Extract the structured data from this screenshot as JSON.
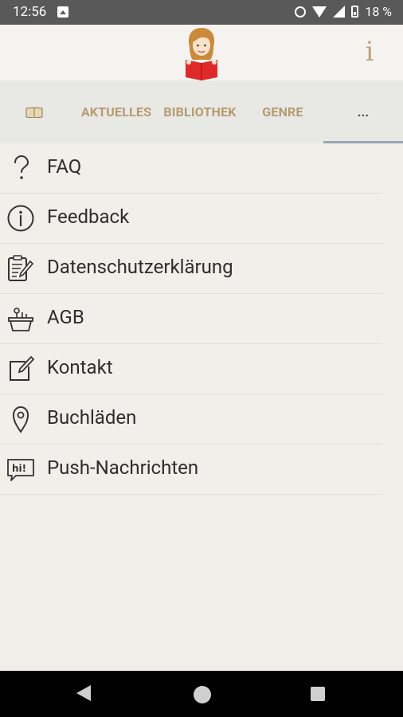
{
  "status_bar": {
    "time": "12:56",
    "battery": "18 %"
  },
  "header": {
    "info_label": "i"
  },
  "tabs": [
    {
      "label": "",
      "icon": "book-icon"
    },
    {
      "label": "AKTUELLES"
    },
    {
      "label": "BIBLIOTHEK"
    },
    {
      "label": "GENRE"
    },
    {
      "label": "..."
    }
  ],
  "menu": [
    {
      "label": "FAQ",
      "icon": "question-icon"
    },
    {
      "label": "Feedback",
      "icon": "info-circle-icon"
    },
    {
      "label": "Datenschutzerklärung",
      "icon": "clipboard-edit-icon"
    },
    {
      "label": "AGB",
      "icon": "basket-icon"
    },
    {
      "label": "Kontakt",
      "icon": "pencil-square-icon"
    },
    {
      "label": "Buchläden",
      "icon": "location-pin-icon"
    },
    {
      "label": "Push-Nachrichten",
      "icon": "hi-speech-bubble-icon"
    }
  ],
  "colors": {
    "accent": "#b59b6f",
    "background": "#f1efea",
    "tab_bg": "#e8e8e5",
    "status_bar": "#595959",
    "indicator": "#9aa6b2"
  }
}
